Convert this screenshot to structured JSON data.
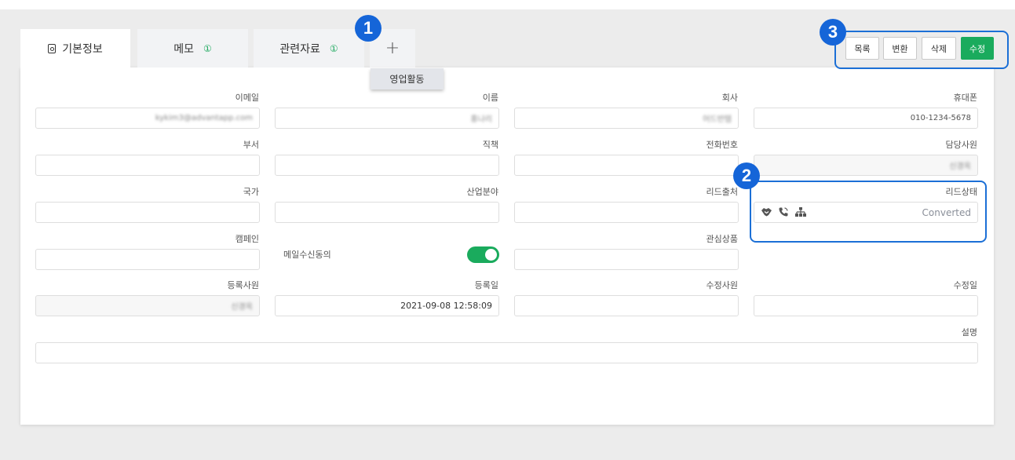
{
  "tabs": [
    {
      "label": "기본정보",
      "icon": "contact-card-icon",
      "active": true
    },
    {
      "label": "메모",
      "count": "①"
    },
    {
      "label": "관련자료",
      "count": "①"
    },
    {
      "label": "+"
    }
  ],
  "dropdown_item": "영업활동",
  "markers": [
    "1",
    "2",
    "3"
  ],
  "actions": {
    "list": "목록",
    "convert": "변환",
    "delete": "삭제",
    "edit": "수정"
  },
  "fields": {
    "email": {
      "label": "이메일",
      "value": "kykim3@advantapp.com"
    },
    "name": {
      "label": "이름",
      "value": "홍나리"
    },
    "company": {
      "label": "회사",
      "value": "어드반템"
    },
    "mobile": {
      "label": "휴대폰",
      "value": "010-1234-5678"
    },
    "department": {
      "label": "부서",
      "value": ""
    },
    "position": {
      "label": "직책",
      "value": ""
    },
    "phone": {
      "label": "전화번호",
      "value": ""
    },
    "owner": {
      "label": "담당사원",
      "value": "신경옥"
    },
    "country": {
      "label": "국가",
      "value": ""
    },
    "industry": {
      "label": "산업분야",
      "value": ""
    },
    "lead_source": {
      "label": "리드출처",
      "value": ""
    },
    "lead_status": {
      "label": "리드상태",
      "value": "Converted",
      "icons": [
        "handshake-icon",
        "phone-icon",
        "org-chart-icon"
      ]
    },
    "campaign": {
      "label": "캠페인",
      "value": ""
    },
    "email_consent": {
      "label": "메일수신동의",
      "on": true
    },
    "product_interest": {
      "label": "관심상품",
      "value": ""
    },
    "registered_by": {
      "label": "등록사원",
      "value": "신경옥"
    },
    "registered_date": {
      "label": "등록일",
      "value": "2021-09-08 12:58:09"
    },
    "modified_by": {
      "label": "수정사원",
      "value": ""
    },
    "modified_date": {
      "label": "수정일",
      "value": ""
    },
    "description": {
      "label": "설명",
      "value": ""
    }
  },
  "colors": {
    "accent": "#1aab5d",
    "marker": "#1565d8",
    "tab_bg": "#f2f3f5"
  }
}
